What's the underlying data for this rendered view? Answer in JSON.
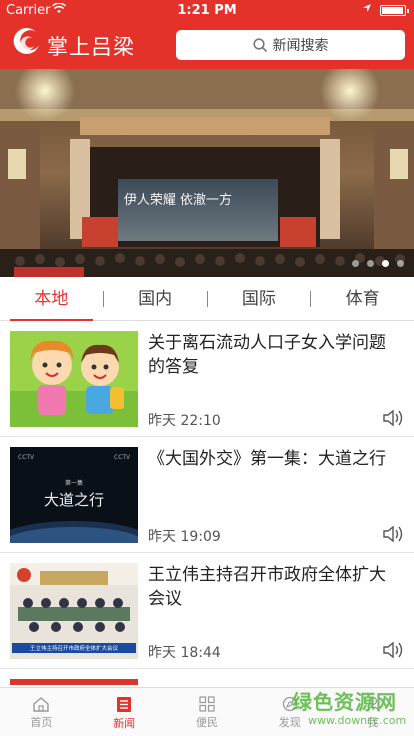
{
  "status_bar": {
    "carrier": "Carrier",
    "time": "1:21 PM",
    "battery_level": 0.95
  },
  "header": {
    "app_title": "掌上吕梁",
    "search_placeholder": "新闻搜索"
  },
  "banner": {
    "screen_text": "伊人荣耀 依澈一方",
    "slide_count": 4,
    "active_slide": 3
  },
  "tabs": [
    {
      "label": "本地",
      "active": true
    },
    {
      "label": "国内",
      "active": false
    },
    {
      "label": "国际",
      "active": false
    },
    {
      "label": "体育",
      "active": false
    }
  ],
  "news": [
    {
      "title": "关于离石流动人口子女入学问题的答复",
      "time": "昨天 22:10"
    },
    {
      "title": "《大国外交》第一集：大道之行",
      "time": "昨天 19:09",
      "thumb_text": "大道之行",
      "thumb_sub": "第一集"
    },
    {
      "title": "王立伟主持召开市政府全体扩大会议",
      "time": "昨天 18:44",
      "thumb_caption": "王立伟主持召开市政府全体扩大会议"
    }
  ],
  "bottom_nav": [
    {
      "label": "首页",
      "icon": "home-icon",
      "active": false
    },
    {
      "label": "新闻",
      "icon": "news-icon",
      "active": true
    },
    {
      "label": "便民",
      "icon": "grid-icon",
      "active": false
    },
    {
      "label": "发现",
      "icon": "discover-icon",
      "active": false
    },
    {
      "label": "我",
      "icon": "user-icon",
      "active": false
    }
  ],
  "watermark": {
    "text": "绿色资源网",
    "url": "www.downcc.com"
  },
  "colors": {
    "brand_red": "#e4322b",
    "watermark_green": "#5dba47"
  }
}
